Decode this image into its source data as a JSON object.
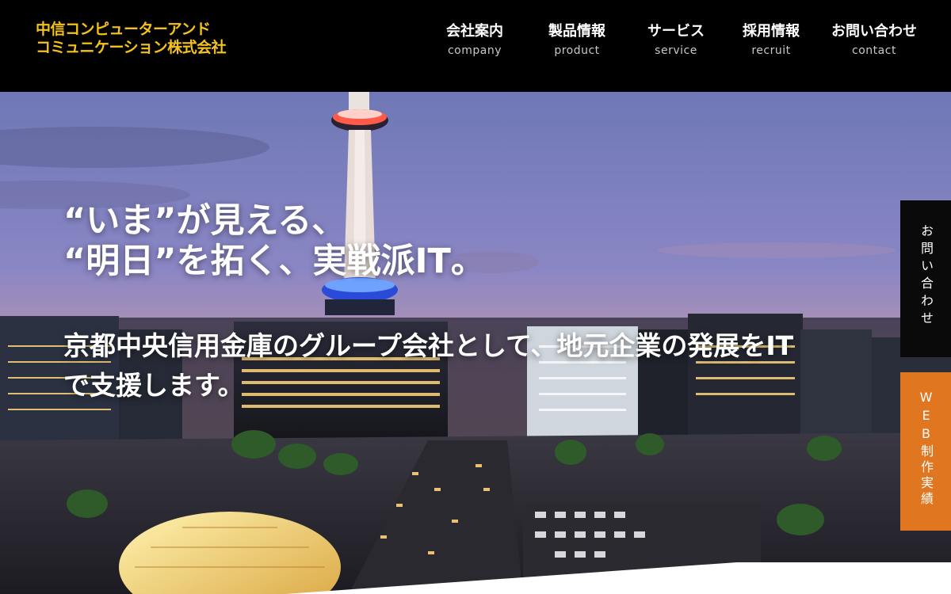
{
  "header": {
    "logo_line1": "中信コンピューターアンド",
    "logo_line2": "コミュニケーション株式会社",
    "nav": [
      {
        "jp": "会社案内",
        "en": "company"
      },
      {
        "jp": "製品情報",
        "en": "product"
      },
      {
        "jp": "サービス",
        "en": "service"
      },
      {
        "jp": "採用情報",
        "en": "recruit"
      },
      {
        "jp": "お問い合わせ",
        "en": "contact"
      }
    ]
  },
  "hero": {
    "headline_line1": "“いま”が見える、",
    "headline_line2": "“明日”を拓く、実戦派IT。",
    "sub_line1": "京都中央信用金庫のグループ会社として、地元企業の発展をIT",
    "sub_line2": "で支援します。"
  },
  "side_tabs": {
    "contact": "お問い合わせ",
    "web": "WEB制作実績"
  },
  "colors": {
    "logo": "#f4c21f",
    "header_bg": "#000000",
    "web_tab": "#e0761f"
  }
}
